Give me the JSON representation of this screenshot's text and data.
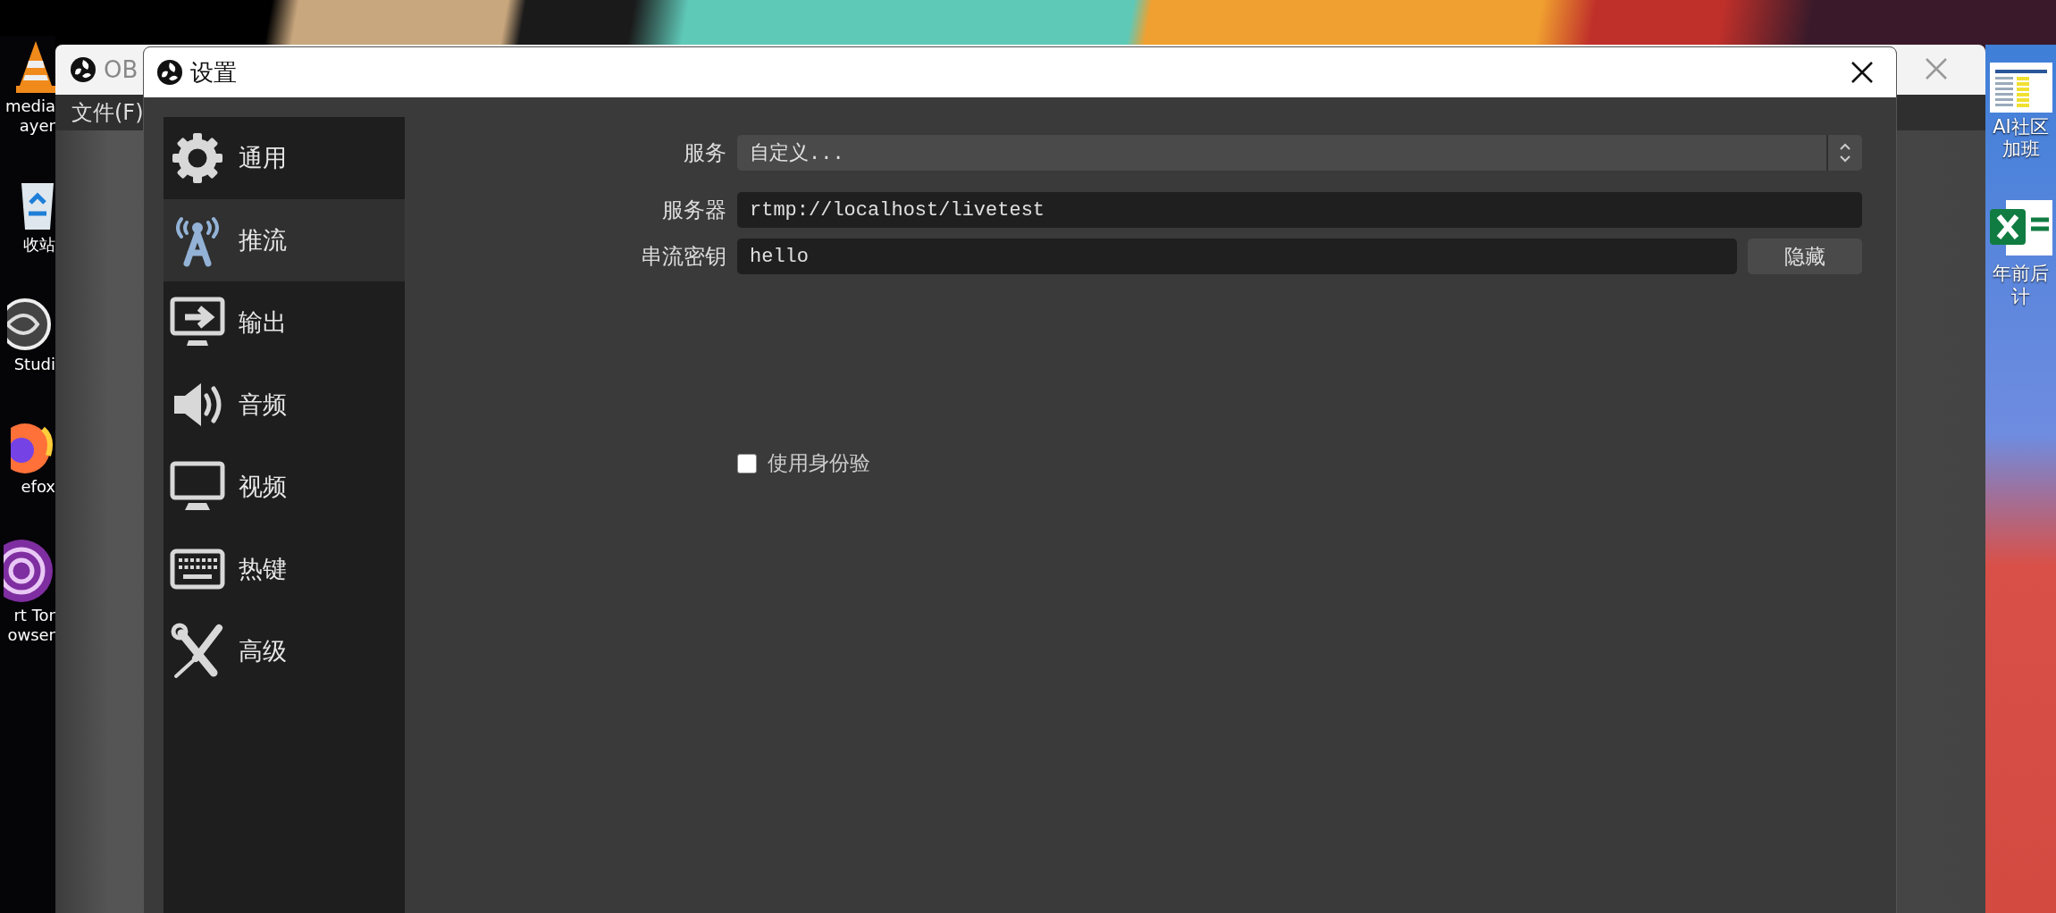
{
  "desktop": {
    "icons_left": [
      {
        "kind": "cone",
        "lines": [
          "media",
          "ayer"
        ]
      },
      {
        "kind": "bin",
        "lines": [
          "收站"
        ]
      },
      {
        "kind": "obs",
        "lines": [
          "Studi"
        ]
      },
      {
        "kind": "fox",
        "lines": [
          "efox"
        ]
      },
      {
        "kind": "tor",
        "lines": [
          "rt Tor",
          "owser"
        ]
      }
    ],
    "icons_right": [
      {
        "kind": "sheet",
        "lines": [
          "AI社区",
          "加班"
        ]
      },
      {
        "kind": "excel",
        "lines": [
          "年前后",
          "计"
        ]
      }
    ]
  },
  "main_window": {
    "title": "OB",
    "menu": [
      "文件(F)"
    ]
  },
  "settings_window": {
    "title": "设置",
    "sidebar": {
      "items": [
        {
          "kind": "general",
          "label": "通用",
          "selected": false
        },
        {
          "kind": "stream",
          "label": "推流",
          "selected": true
        },
        {
          "kind": "output",
          "label": "输出",
          "selected": false
        },
        {
          "kind": "audio",
          "label": "音频",
          "selected": false
        },
        {
          "kind": "video",
          "label": "视频",
          "selected": false
        },
        {
          "kind": "hotkeys",
          "label": "热键",
          "selected": false
        },
        {
          "kind": "advanced",
          "label": "高级",
          "selected": false
        }
      ]
    },
    "form": {
      "rows": [
        {
          "kind": "combo",
          "label": "服务",
          "value": "自定义..."
        },
        {
          "kind": "text",
          "label": "服务器",
          "value": "rtmp://localhost/livetest"
        },
        {
          "kind": "text",
          "label": "串流密钥",
          "value": "hello",
          "button": "隐藏"
        }
      ],
      "checkbox": {
        "label": "使用身份验",
        "checked": false
      }
    }
  }
}
